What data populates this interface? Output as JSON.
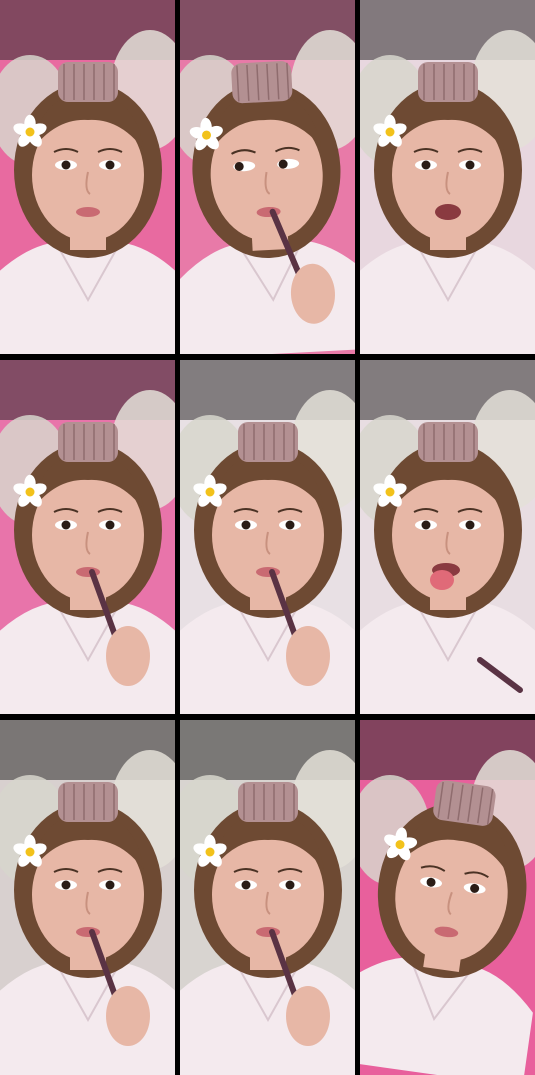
{
  "grid": {
    "rows": 3,
    "columns": 3
  },
  "tiles": [
    {
      "pose": "neutral",
      "flower_side": "left",
      "prop": "none",
      "bg": "#e86aa0"
    },
    {
      "pose": "glance-left",
      "flower_side": "left",
      "prop": "stick-in-hand",
      "bg": "#e87aa8"
    },
    {
      "pose": "mouth-open",
      "flower_side": "left",
      "prop": "none",
      "bg": "#e8d7df"
    },
    {
      "pose": "stick-in-mouth",
      "flower_side": "left",
      "prop": "stick",
      "bg": "#e874aa"
    },
    {
      "pose": "stick-in-mouth",
      "flower_side": "left",
      "prop": "stick",
      "bg": "#e8e0e4"
    },
    {
      "pose": "tongue-out",
      "flower_side": "left",
      "prop": "stick-low",
      "bg": "#e8dde2"
    },
    {
      "pose": "stick-in-mouth",
      "flower_side": "left",
      "prop": "stick",
      "bg": "#d8d0cf"
    },
    {
      "pose": "stick-in-mouth",
      "flower_side": "left",
      "prop": "stick",
      "bg": "#d8d4d0"
    },
    {
      "pose": "tilted",
      "flower_side": "left",
      "prop": "none",
      "bg": "#e8609c"
    }
  ],
  "colors": {
    "gap": "#000000",
    "skin": "#e7b7a6",
    "hair": "#6e4a33",
    "shirt": "#f4eaee",
    "curler": "#b39092",
    "petal": "#ffffff",
    "flower_center": "#f2c21a"
  }
}
